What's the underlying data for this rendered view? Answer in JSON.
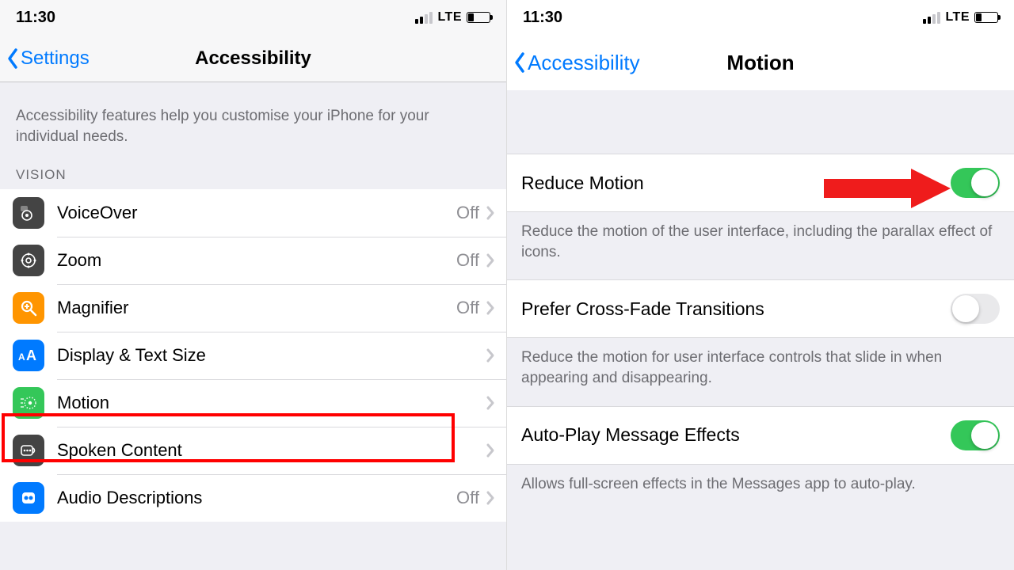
{
  "left": {
    "status": {
      "time": "11:30",
      "network": "LTE"
    },
    "nav": {
      "back_label": "Settings",
      "title": "Accessibility"
    },
    "intro": "Accessibility features help you customise your iPhone for your individual needs.",
    "section_vision": "VISION",
    "rows": [
      {
        "label": "VoiceOver",
        "status": "Off"
      },
      {
        "label": "Zoom",
        "status": "Off"
      },
      {
        "label": "Magnifier",
        "status": "Off"
      },
      {
        "label": "Display & Text Size",
        "status": ""
      },
      {
        "label": "Motion",
        "status": ""
      },
      {
        "label": "Spoken Content",
        "status": ""
      },
      {
        "label": "Audio Descriptions",
        "status": "Off"
      }
    ]
  },
  "right": {
    "status": {
      "time": "11:30",
      "network": "LTE"
    },
    "nav": {
      "back_label": "Accessibility",
      "title": "Motion"
    },
    "groups": [
      {
        "label": "Reduce Motion",
        "on": true,
        "desc": "Reduce the motion of the user interface, including the parallax effect of icons."
      },
      {
        "label": "Prefer Cross-Fade Transitions",
        "on": false,
        "desc": "Reduce the motion for user interface controls that slide in when appearing and disappearing."
      },
      {
        "label": "Auto-Play Message Effects",
        "on": true,
        "desc": "Allows full-screen effects in the Messages app to auto-play."
      }
    ]
  }
}
